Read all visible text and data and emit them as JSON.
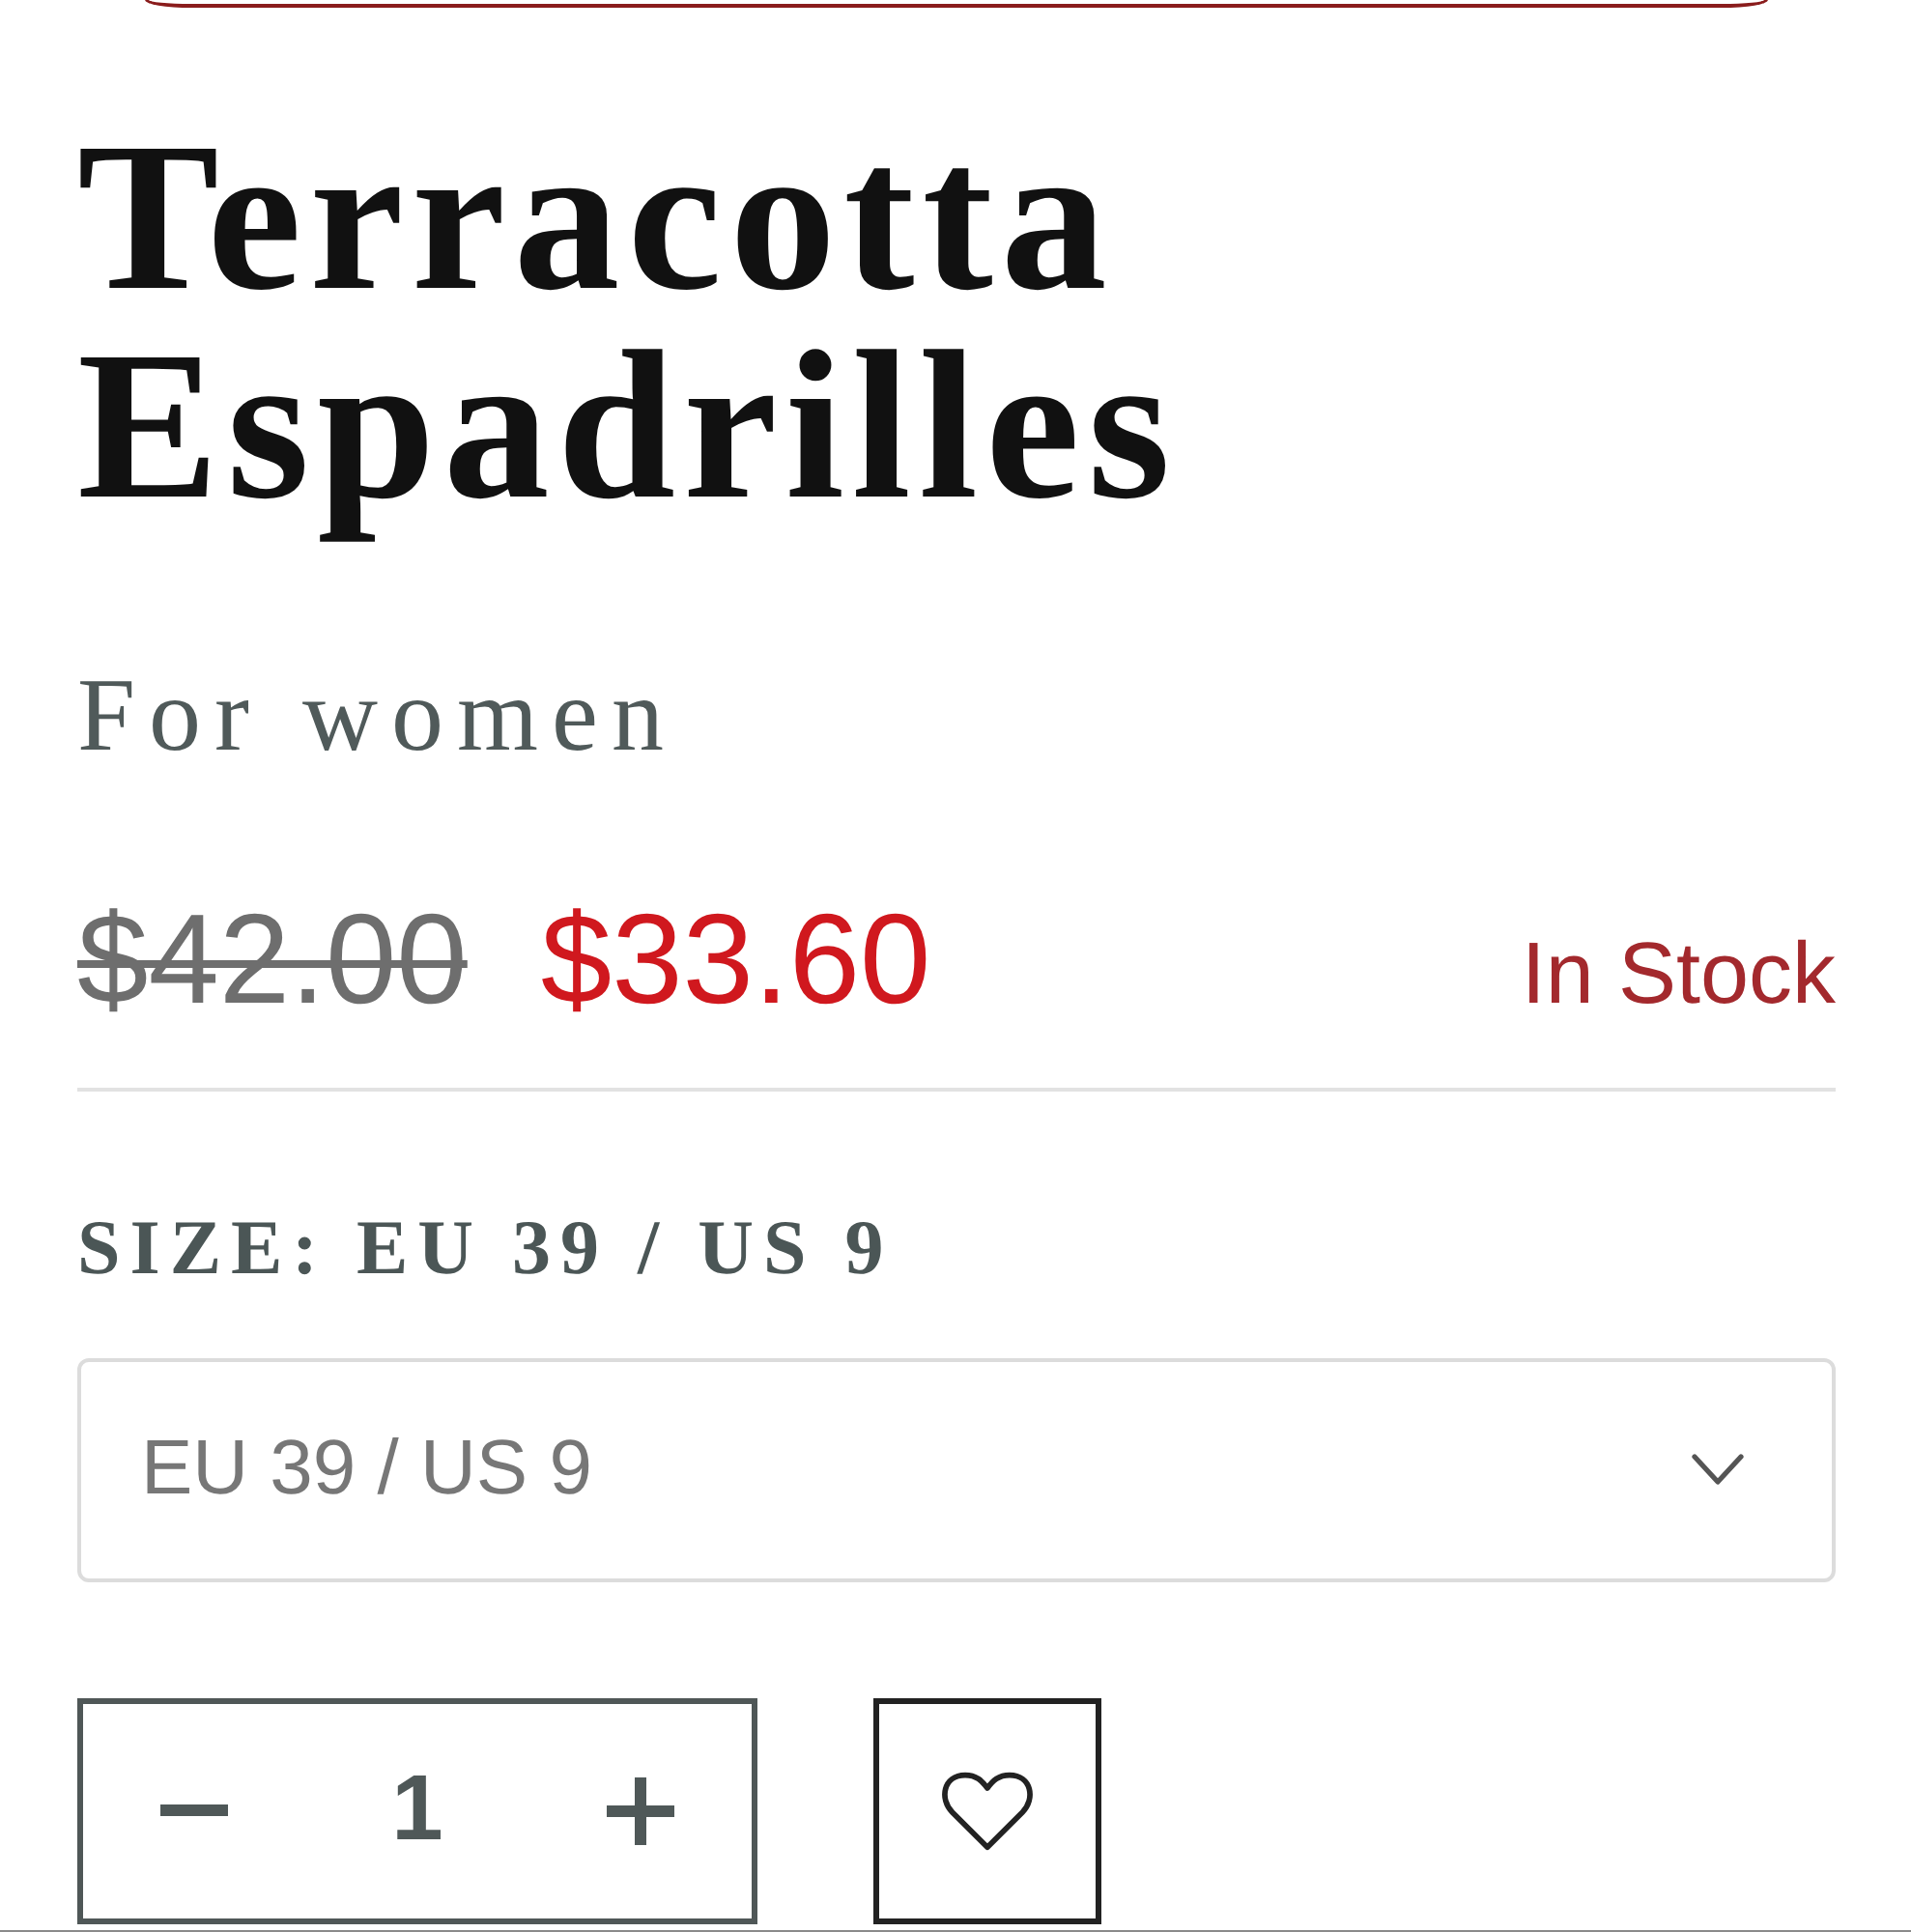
{
  "product": {
    "title": "Terracotta Espadrilles",
    "subtitle": "For women"
  },
  "price": {
    "original": "$42.00",
    "sale": "$33.60",
    "availability": "In Stock"
  },
  "size": {
    "label": "SIZE: EU 39 / US 9",
    "dropdown": {
      "value": "EU 39 / US 9"
    }
  },
  "quantity": {
    "value": "1"
  },
  "wishlist": {
    "saved": false
  }
}
